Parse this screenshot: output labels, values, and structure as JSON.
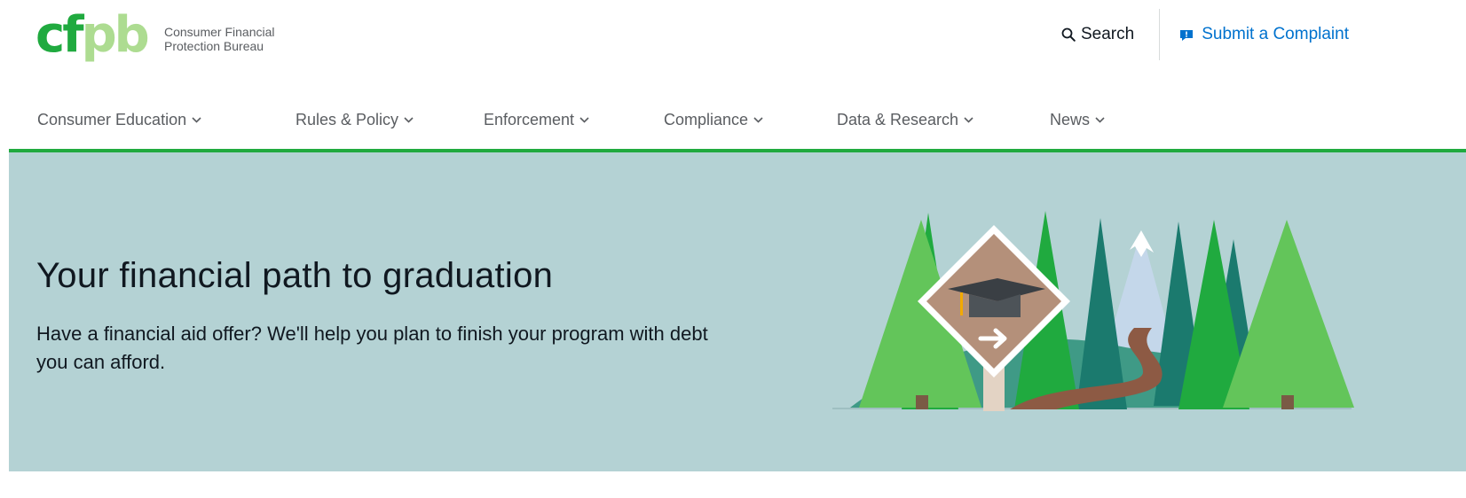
{
  "brand": {
    "logo_letters": "cfpb",
    "name_line1": "Consumer Financial",
    "name_line2": "Protection Bureau",
    "color_primary": "#20aa3f",
    "color_secondary": "#addc91"
  },
  "utility": {
    "search_label": "Search",
    "search_icon": "search-icon",
    "complaint_label": "Submit a Complaint",
    "complaint_icon": "complaint-icon",
    "link_color": "#0072ce"
  },
  "nav": {
    "items": [
      {
        "label": "Consumer Education"
      },
      {
        "label": "Rules & Policy"
      },
      {
        "label": "Enforcement"
      },
      {
        "label": "Compliance"
      },
      {
        "label": "Data & Research"
      },
      {
        "label": "News"
      }
    ],
    "rule_color": "#20aa3f"
  },
  "hero": {
    "title": "Your financial path to graduation",
    "lead": "Have a financial aid offer? We'll help you plan to finish your program with debt you can afford.",
    "background": "#b4d2d4",
    "illustration": "forest-path-graduation-sign"
  }
}
